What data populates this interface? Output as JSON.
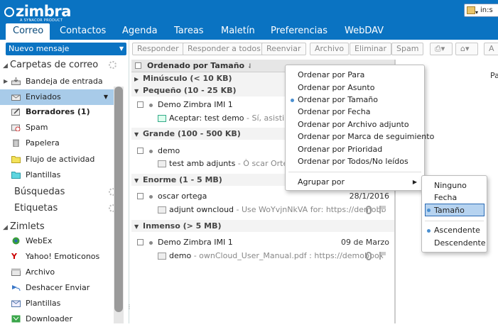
{
  "header": {
    "logo_text": "zimbra",
    "logo_sub": "A SYNACOR PRODUCT",
    "user": "in:s",
    "tabs": [
      "Correo",
      "Contactos",
      "Agenda",
      "Tareas",
      "Maletín",
      "Preferencias",
      "WebDAV"
    ],
    "active_tab": "Correo"
  },
  "sidebar": {
    "new_message": "Nuevo mensaje",
    "mail_header": "Carpetas de correo",
    "folders": [
      {
        "label": "Bandeja de entrada",
        "icon": "inbox-icon"
      },
      {
        "label": "Enviados",
        "icon": "sent-icon"
      },
      {
        "label": "Borradores (1)",
        "icon": "drafts-icon"
      },
      {
        "label": "Spam",
        "icon": "spam-icon"
      },
      {
        "label": "Papelera",
        "icon": "trash-icon"
      },
      {
        "label": "Flujo de actividad",
        "icon": "folder-icon"
      },
      {
        "label": "Plantillas",
        "icon": "folder-icon"
      }
    ],
    "searches": "Búsquedas",
    "tags": "Etiquetas",
    "zimlets_header": "Zimlets",
    "zimlets": [
      {
        "label": "WebEx",
        "icon": "webex-icon"
      },
      {
        "label": "Yahoo! Emoticonos",
        "icon": "yahoo-icon"
      },
      {
        "label": "Archivo",
        "icon": "archive-icon"
      },
      {
        "label": "Deshacer Enviar",
        "icon": "undo-send-icon"
      },
      {
        "label": "Plantillas",
        "icon": "templates-icon"
      },
      {
        "label": "Downloader",
        "icon": "downloader-icon"
      }
    ]
  },
  "toolbar": {
    "reply": "Responder",
    "reply_all": "Responder a todos",
    "forward": "Reenviar",
    "archive": "Archivo",
    "delete": "Eliminar",
    "spam": "Spam"
  },
  "list": {
    "sort_header": "Ordenado por Tamaño",
    "groups": [
      {
        "label": "Minúsculo (< 10 KB)"
      },
      {
        "label": "Pequeño (10 - 25 KB)"
      },
      {
        "label": "Grande (100 - 500 KB)"
      },
      {
        "label": "Enorme (1 - 5 MB)"
      },
      {
        "label": "Inmenso (> 5 MB)"
      }
    ],
    "messages": [
      {
        "from": "Demo Zimbra IMI 1",
        "date": "",
        "subject": "Aceptar: test demo",
        "fragment": " - Sí, asistiré."
      },
      {
        "from": "demo",
        "date": "",
        "subject": "test amb adjunts",
        "fragment": " - Ò scar Ortega"
      },
      {
        "from": "oscar ortega",
        "date": "28/1/2016",
        "subject": "adjunt owncloud",
        "fragment": " - Use WoYvjnNkVA for: https://demobb"
      },
      {
        "from": "Demo Zimbra IMI 1",
        "date": "09 de Marzo",
        "subject": "demo",
        "fragment": " - ownCloud_User_Manual.pdf : https://demobbox"
      }
    ]
  },
  "reading": {
    "partial": "Pa"
  },
  "sort_menu": {
    "items": [
      "Ordenar por Para",
      "Ordenar por Asunto",
      "Ordenar por Tamaño",
      "Ordenar por Fecha",
      "Ordenar por Archivo adjunto",
      "Ordenar por Marca de seguimiento",
      "Ordenar por Prioridad",
      "Ordenar por Todos/No leídos"
    ],
    "selected": "Ordenar por Tamaño",
    "group_by": "Agrupar por"
  },
  "group_menu": {
    "items": [
      "Ninguno",
      "Fecha",
      "Tamaño"
    ],
    "selected": "Tamaño",
    "order": [
      "Ascendente",
      "Descendente"
    ],
    "order_selected": "Ascendente"
  },
  "colors": {
    "brand": "#0a73c2",
    "selection": "#a8cbe9",
    "menu_highlight": "#b6d3f0"
  }
}
